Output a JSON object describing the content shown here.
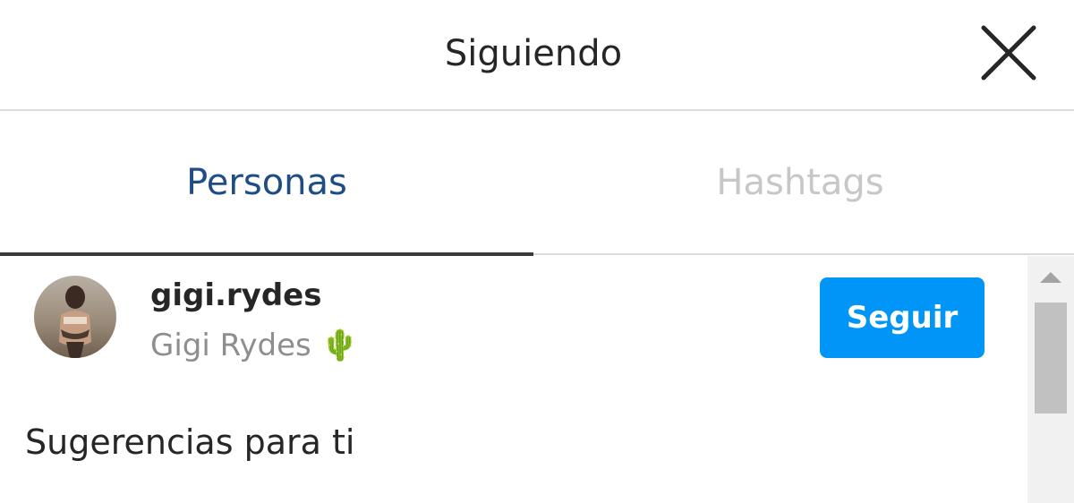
{
  "dialog": {
    "title": "Siguiendo",
    "close_icon": "close-icon"
  },
  "tabs": [
    {
      "label": "Personas",
      "active": true
    },
    {
      "label": "Hashtags",
      "active": false
    }
  ],
  "following": [
    {
      "username": "gigi.rydes",
      "full_name": "Gigi Rydes 🌵",
      "follow_label": "Seguir"
    }
  ],
  "suggestions": {
    "title": "Sugerencias para ti"
  },
  "colors": {
    "accent": "#0095f6",
    "active_tab": "#1f4e86",
    "inactive_tab": "#c7c7c7",
    "text": "#262626",
    "secondary_text": "#8e8e8e"
  }
}
